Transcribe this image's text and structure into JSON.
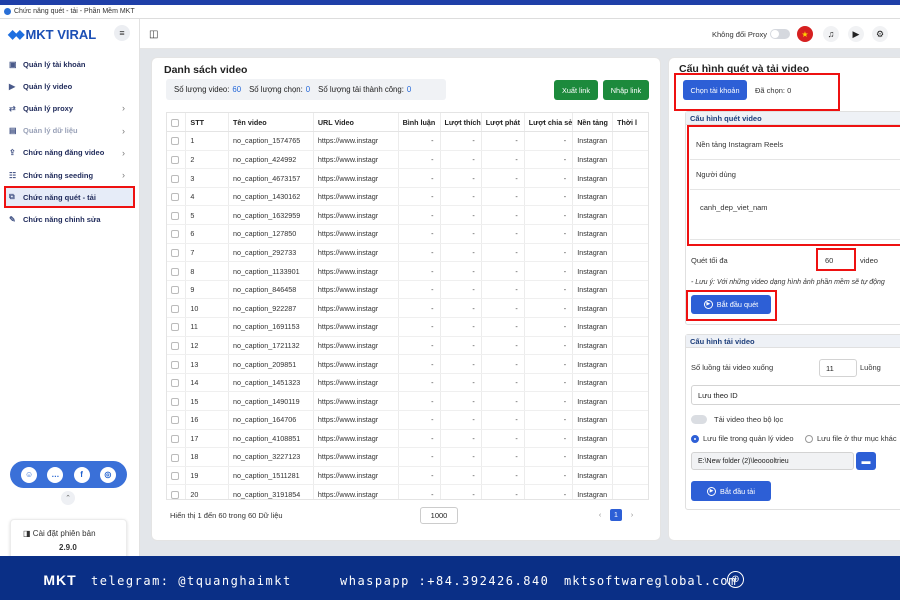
{
  "window": {
    "title": "Chức năng quét - tải - Phần Mềm MKT"
  },
  "logo": {
    "text": "MKT VIRAL"
  },
  "sidebar": {
    "items": [
      {
        "label": "Quản lý tài khoản",
        "icon": "user-card-icon",
        "chev": ""
      },
      {
        "label": "Quản lý video",
        "icon": "video-icon",
        "chev": ""
      },
      {
        "label": "Quản lý proxy",
        "icon": "proxy-icon",
        "chev": "›"
      },
      {
        "label": "Quản lý dữ liệu",
        "icon": "data-icon",
        "chev": "›"
      },
      {
        "label": "Chức năng đăng video",
        "icon": "upload-icon",
        "chev": "›"
      },
      {
        "label": "Chức năng seeding",
        "icon": "seeding-icon",
        "chev": "›"
      },
      {
        "label": "Chức năng quét - tải",
        "icon": "scan-icon",
        "chev": ""
      },
      {
        "label": "Chức năng chỉnh sửa",
        "icon": "edit-icon",
        "chev": ""
      }
    ],
    "version_label": "Cài đặt phiên bản",
    "version": "2.9.0"
  },
  "header": {
    "proxy_label": "Không đổi Proxy"
  },
  "left": {
    "title": "Danh sách video",
    "count_video_label": "Số lượng video:",
    "count_video": "60",
    "count_selected_label": "Số lượng chọn:",
    "count_selected": "0",
    "count_success_label": "Số lượng tải thành công:",
    "count_success": "0",
    "export_label": "Xuất link",
    "import_label": "Nhập link",
    "columns": [
      "STT",
      "Tên video",
      "URL Video",
      "Bình luận",
      "Lượt thích",
      "Lượt phát",
      "Lượt chia sẻ",
      "Nền tảng",
      "Thời l"
    ],
    "rows": [
      [
        "1",
        "no_caption_1574765",
        "https://www.instagr",
        "-",
        "-",
        "-",
        "-",
        "Instagran"
      ],
      [
        "2",
        "no_caption_424992",
        "https://www.instagr",
        "-",
        "-",
        "-",
        "-",
        "Instagran"
      ],
      [
        "3",
        "no_caption_4673157",
        "https://www.instagr",
        "-",
        "-",
        "-",
        "-",
        "Instagran"
      ],
      [
        "4",
        "no_caption_1430162",
        "https://www.instagr",
        "-",
        "-",
        "-",
        "-",
        "Instagran"
      ],
      [
        "5",
        "no_caption_1632959",
        "https://www.instagr",
        "-",
        "-",
        "-",
        "-",
        "Instagran"
      ],
      [
        "6",
        "no_caption_127850",
        "https://www.instagr",
        "-",
        "-",
        "-",
        "-",
        "Instagran"
      ],
      [
        "7",
        "no_caption_292733",
        "https://www.instagr",
        "-",
        "-",
        "-",
        "-",
        "Instagran"
      ],
      [
        "8",
        "no_caption_1133901",
        "https://www.instagr",
        "-",
        "-",
        "-",
        "-",
        "Instagran"
      ],
      [
        "9",
        "no_caption_846458",
        "https://www.instagr",
        "-",
        "-",
        "-",
        "-",
        "Instagran"
      ],
      [
        "10",
        "no_caption_922287",
        "https://www.instagr",
        "-",
        "-",
        "-",
        "-",
        "Instagran"
      ],
      [
        "11",
        "no_caption_1691153",
        "https://www.instagr",
        "-",
        "-",
        "-",
        "-",
        "Instagran"
      ],
      [
        "12",
        "no_caption_1721132",
        "https://www.instagr",
        "-",
        "-",
        "-",
        "-",
        "Instagran"
      ],
      [
        "13",
        "no_caption_209851",
        "https://www.instagr",
        "-",
        "-",
        "-",
        "-",
        "Instagran"
      ],
      [
        "14",
        "no_caption_1451323",
        "https://www.instagr",
        "-",
        "-",
        "-",
        "-",
        "Instagran"
      ],
      [
        "15",
        "no_caption_1490119",
        "https://www.instagr",
        "-",
        "-",
        "-",
        "-",
        "Instagran"
      ],
      [
        "16",
        "no_caption_164706",
        "https://www.instagr",
        "-",
        "-",
        "-",
        "-",
        "Instagran"
      ],
      [
        "17",
        "no_caption_4108851",
        "https://www.instagr",
        "-",
        "-",
        "-",
        "-",
        "Instagran"
      ],
      [
        "18",
        "no_caption_3227123",
        "https://www.instagr",
        "-",
        "-",
        "-",
        "-",
        "Instagran"
      ],
      [
        "19",
        "no_caption_1511281",
        "https://www.instagr",
        "-",
        "-",
        "-",
        "-",
        "Instagran"
      ],
      [
        "20",
        "no_caption_3191854",
        "https://www.instagr",
        "-",
        "-",
        "-",
        "-",
        "Instagran"
      ]
    ],
    "footer_info": "Hiển thị 1 đến 60 trong 60 Dữ liệu",
    "page_size": "1000",
    "page_prev": "‹",
    "page_current": "1",
    "page_next": "›"
  },
  "right": {
    "title": "Cấu hình quét và tải video",
    "choose_account_label": "Chọn tài khoản",
    "selected_label": "Đã chọn: 0",
    "scan_section_title": "Cấu hình quét video",
    "platform": "Nền tảng Instagram Reels",
    "mode": "Người dùng",
    "keyword": "canh_dep_viet_nam",
    "max_scan_label": "Quét tối đa",
    "max_scan_value": "60",
    "max_scan_unit": "video",
    "note": "- Lưu ý: Với những video dạng hình ảnh phần mềm sẽ tự động",
    "start_scan_label": "Bắt đầu quét",
    "download_section_title": "Cấu hình tải video",
    "threads_label": "Số luồng tải video xuống",
    "threads_value": "11",
    "threads_unit": "Luồng",
    "save_by": "Lưu theo ID",
    "filter_label": "Tải video theo bộ lọc",
    "radio_manage_label": "Lưu file trong quản lý video",
    "radio_folder_label": "Lưu file ở thư mục khác",
    "folder_path": "E:\\New folder (2)\\leooooltrieu",
    "start_download_label": "Bắt đầu tải"
  },
  "footer": {
    "brand": "MKT",
    "telegram": "telegram: @tquanghaimkt",
    "whatsapp": "whaspapp :+84.392426.840",
    "website": "mktsoftwareglobal.com"
  },
  "colors": {
    "primary": "#2d5fd6",
    "green": "#1c8a3c",
    "highlight": "#ee1111",
    "footer_bg": "#0a2f86"
  }
}
